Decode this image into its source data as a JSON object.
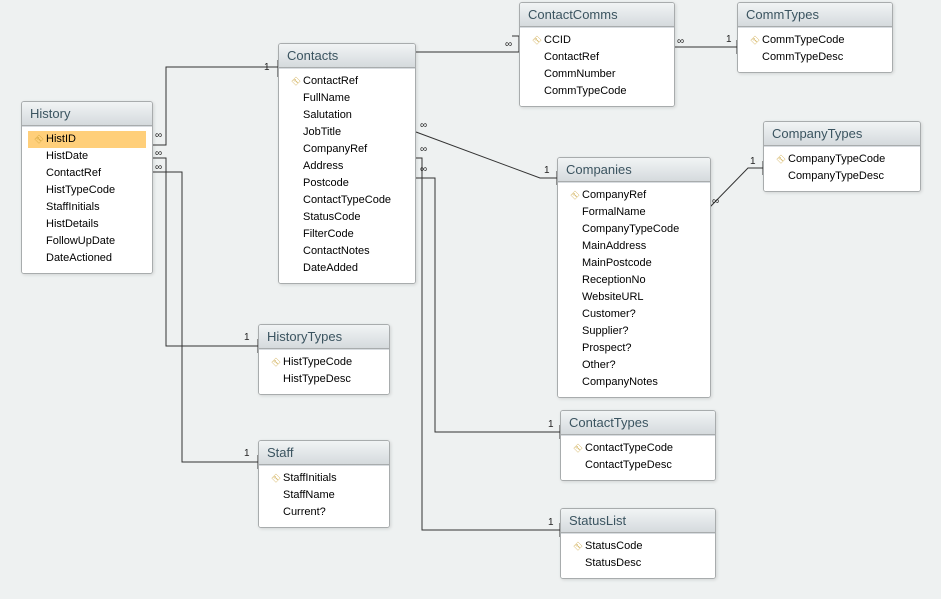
{
  "tables": {
    "history": {
      "title": "History",
      "fields": [
        {
          "name": "HistID",
          "pk": true,
          "selected": true
        },
        {
          "name": "HistDate",
          "pk": false
        },
        {
          "name": "ContactRef",
          "pk": false
        },
        {
          "name": "HistTypeCode",
          "pk": false
        },
        {
          "name": "StaffInitials",
          "pk": false
        },
        {
          "name": "HistDetails",
          "pk": false
        },
        {
          "name": "FollowUpDate",
          "pk": false
        },
        {
          "name": "DateActioned",
          "pk": false
        }
      ]
    },
    "contacts": {
      "title": "Contacts",
      "fields": [
        {
          "name": "ContactRef",
          "pk": true
        },
        {
          "name": "FullName",
          "pk": false
        },
        {
          "name": "Salutation",
          "pk": false
        },
        {
          "name": "JobTitle",
          "pk": false
        },
        {
          "name": "CompanyRef",
          "pk": false
        },
        {
          "name": "Address",
          "pk": false
        },
        {
          "name": "Postcode",
          "pk": false
        },
        {
          "name": "ContactTypeCode",
          "pk": false
        },
        {
          "name": "StatusCode",
          "pk": false
        },
        {
          "name": "FilterCode",
          "pk": false
        },
        {
          "name": "ContactNotes",
          "pk": false
        },
        {
          "name": "DateAdded",
          "pk": false
        }
      ]
    },
    "contactcomms": {
      "title": "ContactComms",
      "fields": [
        {
          "name": "CCID",
          "pk": true
        },
        {
          "name": "ContactRef",
          "pk": false
        },
        {
          "name": "CommNumber",
          "pk": false
        },
        {
          "name": "CommTypeCode",
          "pk": false
        }
      ]
    },
    "commtypes": {
      "title": "CommTypes",
      "fields": [
        {
          "name": "CommTypeCode",
          "pk": true
        },
        {
          "name": "CommTypeDesc",
          "pk": false
        }
      ]
    },
    "historytypes": {
      "title": "HistoryTypes",
      "fields": [
        {
          "name": "HistTypeCode",
          "pk": true
        },
        {
          "name": "HistTypeDesc",
          "pk": false
        }
      ]
    },
    "staff": {
      "title": "Staff",
      "fields": [
        {
          "name": "StaffInitials",
          "pk": true
        },
        {
          "name": "StaffName",
          "pk": false
        },
        {
          "name": "Current?",
          "pk": false
        }
      ]
    },
    "companies": {
      "title": "Companies",
      "fields": [
        {
          "name": "CompanyRef",
          "pk": true
        },
        {
          "name": "FormalName",
          "pk": false
        },
        {
          "name": "CompanyTypeCode",
          "pk": false
        },
        {
          "name": "MainAddress",
          "pk": false
        },
        {
          "name": "MainPostcode",
          "pk": false
        },
        {
          "name": "ReceptionNo",
          "pk": false
        },
        {
          "name": "WebsiteURL",
          "pk": false
        },
        {
          "name": "Customer?",
          "pk": false
        },
        {
          "name": "Supplier?",
          "pk": false
        },
        {
          "name": "Prospect?",
          "pk": false
        },
        {
          "name": "Other?",
          "pk": false
        },
        {
          "name": "CompanyNotes",
          "pk": false
        }
      ]
    },
    "companytypes": {
      "title": "CompanyTypes",
      "fields": [
        {
          "name": "CompanyTypeCode",
          "pk": true
        },
        {
          "name": "CompanyTypeDesc",
          "pk": false
        }
      ]
    },
    "contacttypes": {
      "title": "ContactTypes",
      "fields": [
        {
          "name": "ContactTypeCode",
          "pk": true
        },
        {
          "name": "ContactTypeDesc",
          "pk": false
        }
      ]
    },
    "statuslist": {
      "title": "StatusList",
      "fields": [
        {
          "name": "StatusCode",
          "pk": true
        },
        {
          "name": "StatusDesc",
          "pk": false
        }
      ]
    }
  },
  "cardinality": {
    "one": "1",
    "many": "∞"
  }
}
